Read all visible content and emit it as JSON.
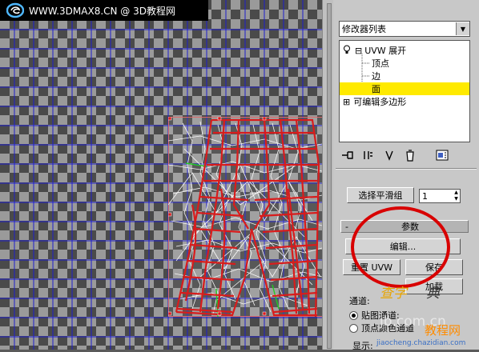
{
  "header": {
    "site_text": "WWW.3DMAX8.CN @ 3D教程网"
  },
  "modifier_list": {
    "label": "修改器列表"
  },
  "stack": {
    "items": [
      {
        "label": "UVW 展开",
        "prefix": "⊟"
      },
      {
        "label": "顶点"
      },
      {
        "label": "边"
      },
      {
        "label": "面"
      },
      {
        "label": "可编辑多边形",
        "prefix": "⊞"
      }
    ]
  },
  "smoothing": {
    "button_label": "选择平滑组",
    "value": "1"
  },
  "params": {
    "rollout_minus": "-",
    "rollout_title": "参数",
    "edit_button": "编辑...",
    "reset_uvw_button": "重置 UVW",
    "save_button": "保存",
    "load_button": "加载",
    "channel_label": "通道:",
    "map_channel_label": "贴图通道:",
    "vertex_color_label": "顶点颜色通道",
    "display_label": "显示:"
  },
  "watermarks": {
    "yellow": "查字",
    "dark": "典",
    "tutorial": "教程网",
    "url1": "jb.com.cn",
    "url2": "jiaocheng.chazidian.com"
  },
  "colors": {
    "selection": "#ffea00",
    "annotation_circle": "#d80000",
    "uv_mesh_red": "#d81c1c",
    "uv_mesh_white": "#ffffff",
    "viewport_grid": "#1e1ecc"
  }
}
